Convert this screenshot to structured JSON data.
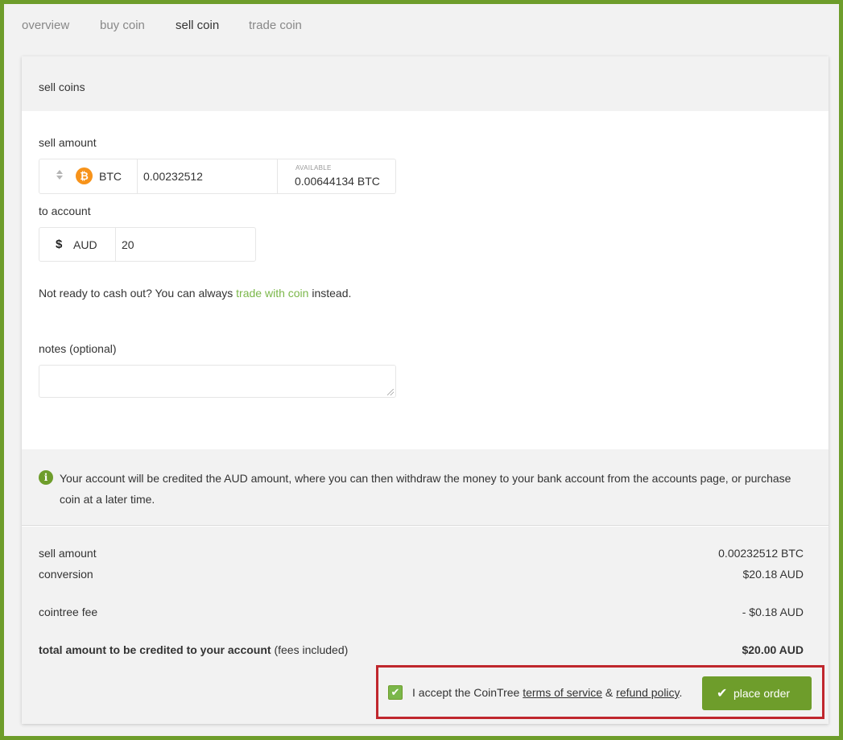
{
  "nav": {
    "tabs": [
      {
        "label": "overview"
      },
      {
        "label": "buy coin"
      },
      {
        "label": "sell coin"
      },
      {
        "label": "trade coin"
      }
    ],
    "active_tab": "sell coin"
  },
  "card": {
    "title": "sell coins",
    "sell_amount": {
      "label": "sell amount",
      "currency_icon": "bitcoin-icon",
      "currency": "BTC",
      "value": "0.00232512",
      "available_label": "AVAILABLE",
      "available_value": "0.00644134 BTC"
    },
    "to_account": {
      "label": "to account",
      "currency_icon": "dollar-icon",
      "currency": "AUD",
      "value": "20"
    },
    "hint": {
      "prefix": "Not ready to cash out? You can always ",
      "link": "trade with coin",
      "suffix": " instead."
    },
    "notes": {
      "label": "notes (optional)",
      "value": ""
    },
    "info": {
      "icon": "info-icon",
      "text": "Your account will be credited the AUD amount, where you can then withdraw the money to your bank account from the accounts page, or purchase coin at a later time."
    },
    "summary": {
      "sell_amount_label": "sell amount",
      "sell_amount_value": "0.00232512 BTC",
      "conversion_label": "conversion",
      "conversion_value": "$20.18 AUD",
      "fee_label": "cointree fee",
      "fee_value": "- $0.18 AUD",
      "total_label": "total amount to be credited to your account",
      "total_note": "(fees included)",
      "total_value": "$20.00 AUD"
    },
    "accept": {
      "checked": true,
      "prefix": "I accept the CoinTree ",
      "terms_link": "terms of service",
      "amp": " & ",
      "refund_link": "refund policy",
      "suffix": "."
    },
    "place_order_label": "place order"
  },
  "colors": {
    "brand_green": "#6e9d2b",
    "link_green": "#7bb74a",
    "highlight_red": "#c0272d",
    "bitcoin_orange": "#f7931a"
  }
}
